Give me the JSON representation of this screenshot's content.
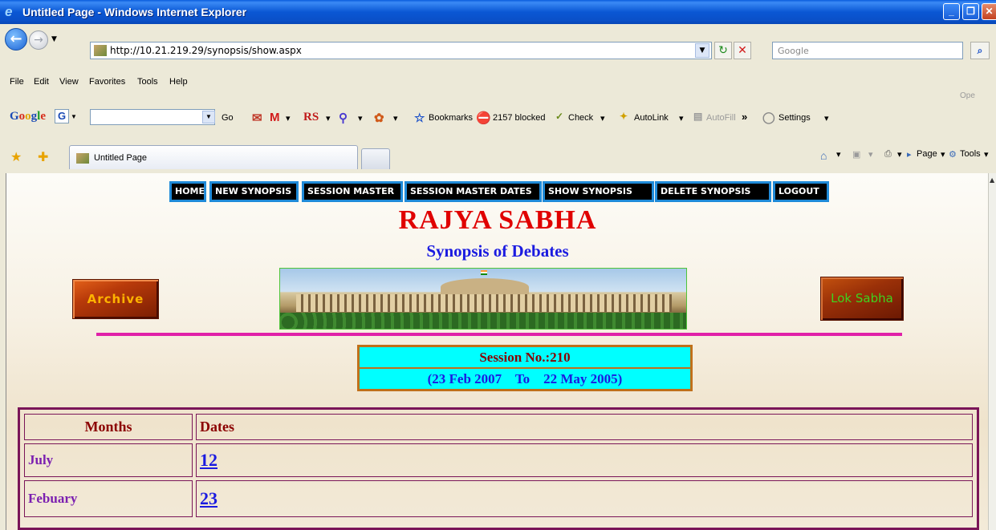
{
  "window": {
    "title": "Untitled Page - Windows Internet Explorer"
  },
  "address": {
    "url": "http://10.21.219.29/synopsis/show.aspx",
    "search_placeholder": "Google"
  },
  "menu": [
    "File",
    "Edit",
    "View",
    "Favorites",
    "Tools",
    "Help"
  ],
  "google_toolbar": {
    "go_label": "Go",
    "rs_label": "RS",
    "bookmarks_label": "Bookmarks",
    "blocked_label": "2157 blocked",
    "check_label": "Check",
    "autolink_label": "AutoLink",
    "autofill_label": "AutoFill",
    "more_label": "»",
    "settings_label": "Settings",
    "ope_label": "Ope"
  },
  "tabs": [
    {
      "label": "Untitled Page"
    }
  ],
  "command_bar": {
    "page_label": "Page",
    "tools_label": "Tools"
  },
  "nav": [
    "HOME",
    "NEW SYNOPSIS",
    "SESSION MASTER",
    "SESSION MASTER DATES",
    "SHOW SYNOPSIS",
    "DELETE SYNOPSIS",
    "LOGOUT"
  ],
  "header": {
    "title": "RAJYA SABHA",
    "subtitle": "Synopsis of Debates"
  },
  "buttons": {
    "archive": "Archive",
    "lok_sabha": "Lok Sabha"
  },
  "session": {
    "number_text": "Session No.:210",
    "range_text": "(23 Feb 2007    To    22 May 2005)"
  },
  "table": {
    "headers": [
      "Months",
      "Dates"
    ],
    "rows": [
      {
        "month": "July",
        "date": "12"
      },
      {
        "month": "Febuary",
        "date": "23"
      }
    ]
  }
}
